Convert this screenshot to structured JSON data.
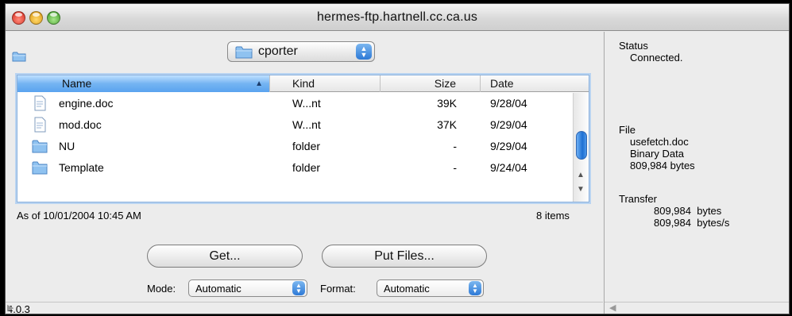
{
  "window": {
    "title": "hermes-ftp.hartnell.cc.ca.us"
  },
  "location_popup": {
    "value": "cporter"
  },
  "list": {
    "columns": {
      "name": "Name",
      "kind": "Kind",
      "size": "Size",
      "date": "Date"
    },
    "rows": [
      {
        "icon": "document-icon",
        "name": "engine.doc",
        "kind": "W...nt",
        "size": "39K",
        "date": "9/28/04"
      },
      {
        "icon": "document-icon",
        "name": "mod.doc",
        "kind": "W...nt",
        "size": "37K",
        "date": "9/29/04"
      },
      {
        "icon": "folder-icon",
        "name": "NU",
        "kind": "folder",
        "size": "-",
        "date": "9/29/04"
      },
      {
        "icon": "folder-icon",
        "name": "Template",
        "kind": "folder",
        "size": "-",
        "date": "9/24/04"
      }
    ]
  },
  "listing_status": {
    "as_of": "As of 10/01/2004 10:45 AM",
    "count": "8 items"
  },
  "buttons": {
    "get": "Get...",
    "put": "Put Files..."
  },
  "options": {
    "mode_label": "Mode:",
    "mode_value": "Automatic",
    "format_label": "Format:",
    "format_value": "Automatic"
  },
  "version": "4.0.3",
  "side_panel": {
    "status_heading": "Status",
    "status_value": "Connected.",
    "file_heading": "File",
    "file_name": "usefetch.doc",
    "file_type": "Binary Data",
    "file_size": "809,984 bytes",
    "transfer_heading": "Transfer",
    "transfer_bytes": "809,984  bytes",
    "transfer_rate": "809,984  bytes/s"
  },
  "colors": {
    "accent": "#5aa3ef",
    "folder": "#7fb6ea"
  }
}
